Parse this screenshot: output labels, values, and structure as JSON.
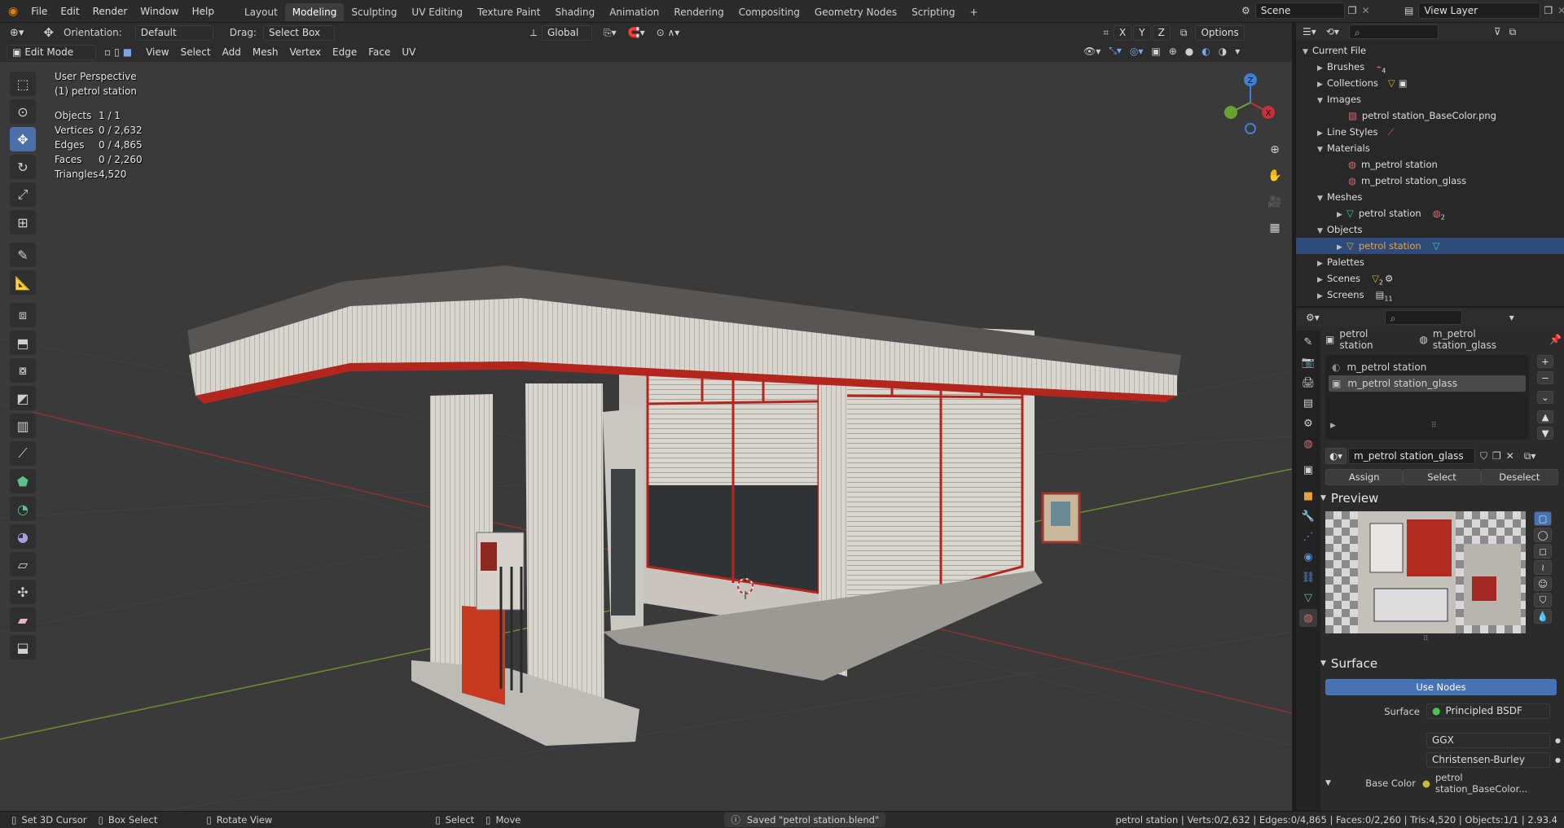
{
  "topbar": {
    "menus": [
      "File",
      "Edit",
      "Render",
      "Window",
      "Help"
    ],
    "workspaces": [
      "Layout",
      "Modeling",
      "Sculpting",
      "UV Editing",
      "Texture Paint",
      "Shading",
      "Animation",
      "Rendering",
      "Compositing",
      "Geometry Nodes",
      "Scripting"
    ],
    "active_workspace": "Modeling",
    "add_tab": "+",
    "scene": "Scene",
    "view_layer": "View Layer"
  },
  "header2": {
    "orientation_label": "Orientation:",
    "orientation_value": "Default",
    "drag_label": "Drag:",
    "drag_value": "Select Box",
    "transform_orientation": "Global",
    "axis_x": "X",
    "axis_y": "Y",
    "axis_z": "Z",
    "options": "Options"
  },
  "header3": {
    "mode": "Edit Mode",
    "menus": [
      "View",
      "Select",
      "Add",
      "Mesh",
      "Vertex",
      "Edge",
      "Face",
      "UV"
    ]
  },
  "overlay": {
    "view_name": "User Perspective",
    "object_name": "(1) petrol station",
    "stats": [
      {
        "label": "Objects",
        "value": "1 / 1"
      },
      {
        "label": "Vertices",
        "value": "0 / 2,632"
      },
      {
        "label": "Edges",
        "value": "0 / 4,865"
      },
      {
        "label": "Faces",
        "value": "0 / 2,260"
      },
      {
        "label": "Triangles",
        "value": "4,520"
      }
    ]
  },
  "gizmo": {
    "z": "Z",
    "x": "X",
    "y": "Y"
  },
  "outliner": {
    "root": "Current File",
    "rows": [
      {
        "label": "Brushes",
        "indent": 1,
        "open": false,
        "badge": "4"
      },
      {
        "label": "Collections",
        "indent": 1,
        "open": false
      },
      {
        "label": "Images",
        "indent": 1,
        "open": true
      },
      {
        "label": "petrol station_BaseColor.png",
        "indent": 2
      },
      {
        "label": "Line Styles",
        "indent": 1,
        "open": false
      },
      {
        "label": "Materials",
        "indent": 1,
        "open": true
      },
      {
        "label": "m_petrol station",
        "indent": 2
      },
      {
        "label": "m_petrol station_glass",
        "indent": 2
      },
      {
        "label": "Meshes",
        "indent": 1,
        "open": true
      },
      {
        "label": "petrol station",
        "indent": 2,
        "open": false,
        "badge": "2"
      },
      {
        "label": "Objects",
        "indent": 1,
        "open": true
      },
      {
        "label": "petrol station",
        "indent": 2,
        "open": false,
        "selected": true
      },
      {
        "label": "Palettes",
        "indent": 1,
        "open": false
      },
      {
        "label": "Scenes",
        "indent": 1,
        "open": false,
        "badge": "2"
      },
      {
        "label": "Screens",
        "indent": 1,
        "open": false,
        "badge": "11"
      }
    ]
  },
  "properties": {
    "breadcrumb_object": "petrol station",
    "breadcrumb_material": "m_petrol station_glass",
    "slots": [
      "m_petrol station",
      "m_petrol station_glass"
    ],
    "active_slot": 1,
    "material_name": "m_petrol station_glass",
    "assign": "Assign",
    "select": "Select",
    "deselect": "Deselect",
    "preview_title": "Preview",
    "surface_title": "Surface",
    "use_nodes": "Use Nodes",
    "surface_label": "Surface",
    "surface_value": "Principled BSDF",
    "distribution": "GGX",
    "subsurface": "Christensen-Burley",
    "base_color_label": "Base Color",
    "base_color_value": "petrol station_BaseColor..."
  },
  "statusbar": {
    "set_cursor": "Set 3D Cursor",
    "box_select": "Box Select",
    "rotate_view": "Rotate View",
    "select": "Select",
    "move": "Move",
    "message": "Saved \"petrol station.blend\"",
    "stats": "petrol station | Verts:0/2,632 | Edges:0/4,865 | Faces:0/2,260 | Tris:4,520 | Objects:1/1 | 2.93.4"
  },
  "colors": {
    "accent": "#4772b3",
    "selected_row": "#2f4b7c",
    "object_orange": "#e8a13c",
    "red_trim": "#b2261d"
  }
}
